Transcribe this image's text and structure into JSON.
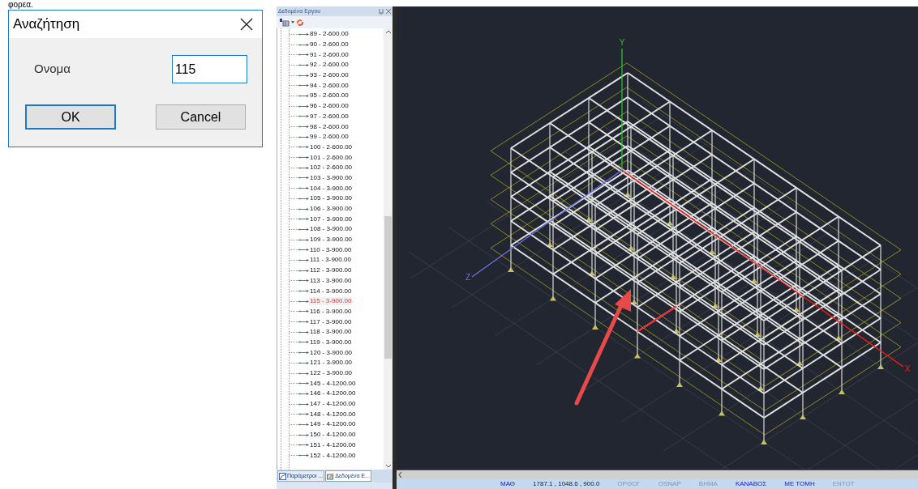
{
  "caption_fragment": "φορεα.",
  "dialog": {
    "title": "Αναζήτηση",
    "field_label": "Ονομα",
    "field_value": "115",
    "buttons": [
      {
        "label": "OK",
        "default": true
      },
      {
        "label": "Cancel",
        "default": false
      }
    ]
  },
  "panel": {
    "title": "Δεδομένα Εργου",
    "items": [
      {
        "label": "89 - 2-600.00",
        "selected": false
      },
      {
        "label": "90 - 2-600.00",
        "selected": false
      },
      {
        "label": "91 - 2-600.00",
        "selected": false
      },
      {
        "label": "92 - 2-600.00",
        "selected": false
      },
      {
        "label": "93 - 2-600.00",
        "selected": false
      },
      {
        "label": "94 - 2-600.00",
        "selected": false
      },
      {
        "label": "95 - 2-600.00",
        "selected": false
      },
      {
        "label": "96 - 2-600.00",
        "selected": false
      },
      {
        "label": "97 - 2-600.00",
        "selected": false
      },
      {
        "label": "98 - 2-600.00",
        "selected": false
      },
      {
        "label": "99 - 2-600.00",
        "selected": false
      },
      {
        "label": "100 - 2-600.00",
        "selected": false
      },
      {
        "label": "101 - 2-600.00",
        "selected": false
      },
      {
        "label": "102 - 2-600.00",
        "selected": false
      },
      {
        "label": "103 - 3-900.00",
        "selected": false
      },
      {
        "label": "104 - 3-900.00",
        "selected": false
      },
      {
        "label": "105 - 3-900.00",
        "selected": false
      },
      {
        "label": "106 - 3-900.00",
        "selected": false
      },
      {
        "label": "107 - 3-900.00",
        "selected": false
      },
      {
        "label": "108 - 3-900.00",
        "selected": false
      },
      {
        "label": "109 - 3-900.00",
        "selected": false
      },
      {
        "label": "110 - 3-900.00",
        "selected": false
      },
      {
        "label": "111 - 3-900.00",
        "selected": false
      },
      {
        "label": "112 - 3-900.00",
        "selected": false
      },
      {
        "label": "113 - 3-900.00",
        "selected": false
      },
      {
        "label": "114 - 3-900.00",
        "selected": false
      },
      {
        "label": "115 - 3-900.00",
        "selected": true
      },
      {
        "label": "116 - 3-900.00",
        "selected": false
      },
      {
        "label": "117 - 3-900.00",
        "selected": false
      },
      {
        "label": "118 - 3-900.00",
        "selected": false
      },
      {
        "label": "119 - 3-900.00",
        "selected": false
      },
      {
        "label": "120 - 3-900.00",
        "selected": false
      },
      {
        "label": "121 - 3-900.00",
        "selected": false
      },
      {
        "label": "122 - 3-900.00",
        "selected": false
      },
      {
        "label": "145 - 4-1200.00",
        "selected": false
      },
      {
        "label": "146 - 4-1200.00",
        "selected": false
      },
      {
        "label": "147 - 4-1200.00",
        "selected": false
      },
      {
        "label": "148 - 4-1200.00",
        "selected": false
      },
      {
        "label": "149 - 4-1200.00",
        "selected": false
      },
      {
        "label": "150 - 4-1200.00",
        "selected": false
      },
      {
        "label": "151 - 4-1200.00",
        "selected": false
      },
      {
        "label": "152 - 4-1200.00",
        "selected": false
      }
    ],
    "tabs": [
      {
        "label": "Παράμετροι ...",
        "selected": false
      },
      {
        "label": "Δεδομένα Ε...",
        "selected": true
      }
    ]
  },
  "viewport": {
    "axes": [
      {
        "label": "Y",
        "kind": "y"
      },
      {
        "label": "Z",
        "kind": "z"
      },
      {
        "label": "X",
        "kind": "x"
      }
    ]
  },
  "status_bar": [
    {
      "label": "ΜΑΘ",
      "kind": "toggle",
      "on": true
    },
    {
      "label": "1787.1 , 1048.6 , 900.0",
      "kind": "coords"
    },
    {
      "label": "ΟΡΘΟΓ",
      "kind": "toggle",
      "on": false
    },
    {
      "label": "OSNAP",
      "kind": "toggle",
      "on": false
    },
    {
      "label": "ΒΗΜΑ",
      "kind": "toggle",
      "on": false
    },
    {
      "label": "ΚΑΝΑΒΟΣ",
      "kind": "toggle",
      "on": true
    },
    {
      "label": "ΜΕ ΤΟΜΗ",
      "kind": "toggle",
      "on": true
    },
    {
      "label": "ΕΝΤΟΤ",
      "kind": "toggle",
      "on": false
    }
  ]
}
